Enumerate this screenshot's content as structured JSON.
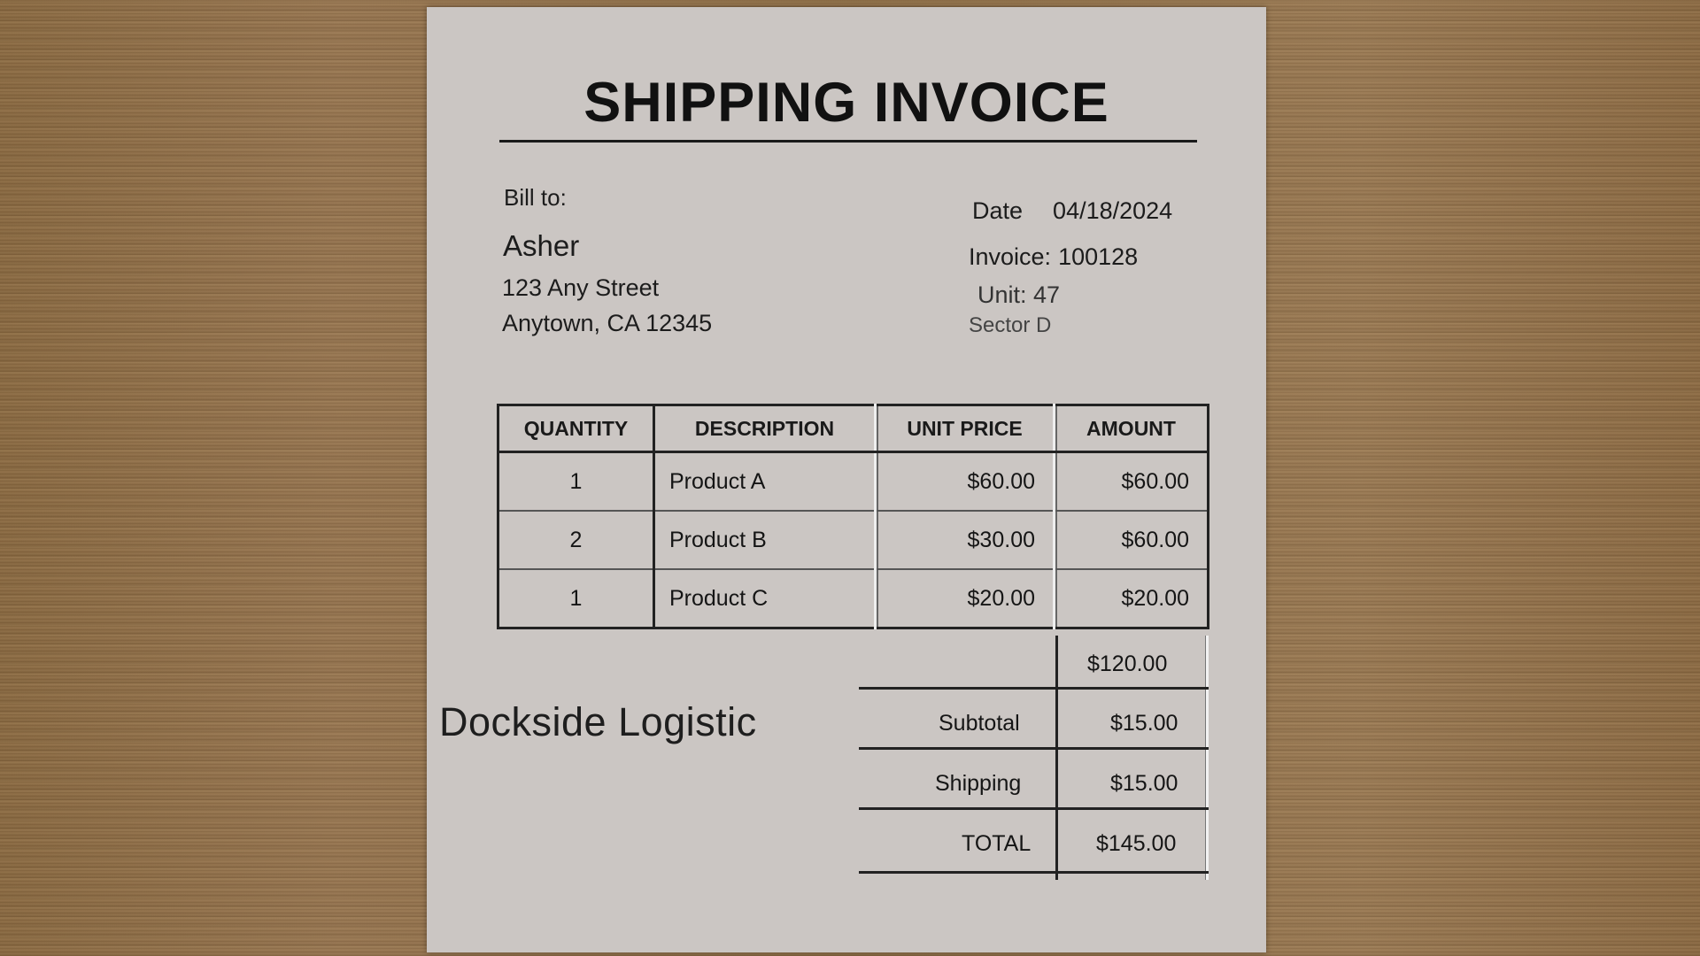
{
  "invoice": {
    "title": "SHIPPING INVOICE",
    "bill_to_label": "Bill to:",
    "customer_name": "Asher",
    "address_line1": "123 Any Street",
    "address_line2": "Anytown, CA 12345",
    "date_label": "Date",
    "date_value": "04/18/2024",
    "invoice_label": "Invoice:",
    "invoice_value": "100128",
    "unit_text": "Unit: 47",
    "sector_text": "Sector D"
  },
  "table": {
    "headers": [
      "QUANTITY",
      "DESCRIPTION",
      "UNIT PRICE",
      "AMOUNT"
    ],
    "rows": [
      {
        "quantity": "1",
        "description": "Product A",
        "unit_price": "$60.00",
        "amount": "$60.00"
      },
      {
        "quantity": "2",
        "description": "Product B",
        "unit_price": "$30.00",
        "amount": "$60.00"
      },
      {
        "quantity": "1",
        "description": "Product C",
        "unit_price": "$20.00",
        "amount": "$20.00"
      }
    ]
  },
  "totals": {
    "sum_value": "$120.00",
    "subtotal_label": "Subtotal",
    "subtotal_value": "$15.00",
    "shipping_label": "Shipping",
    "shipping_value": "$15.00",
    "total_label": "TOTAL",
    "total_value": "$145.00"
  },
  "brand": "Dockside Logistic",
  "colors": {
    "paper": "#cbc6c3",
    "ink": "#151515",
    "wood": "#8f6f48"
  }
}
